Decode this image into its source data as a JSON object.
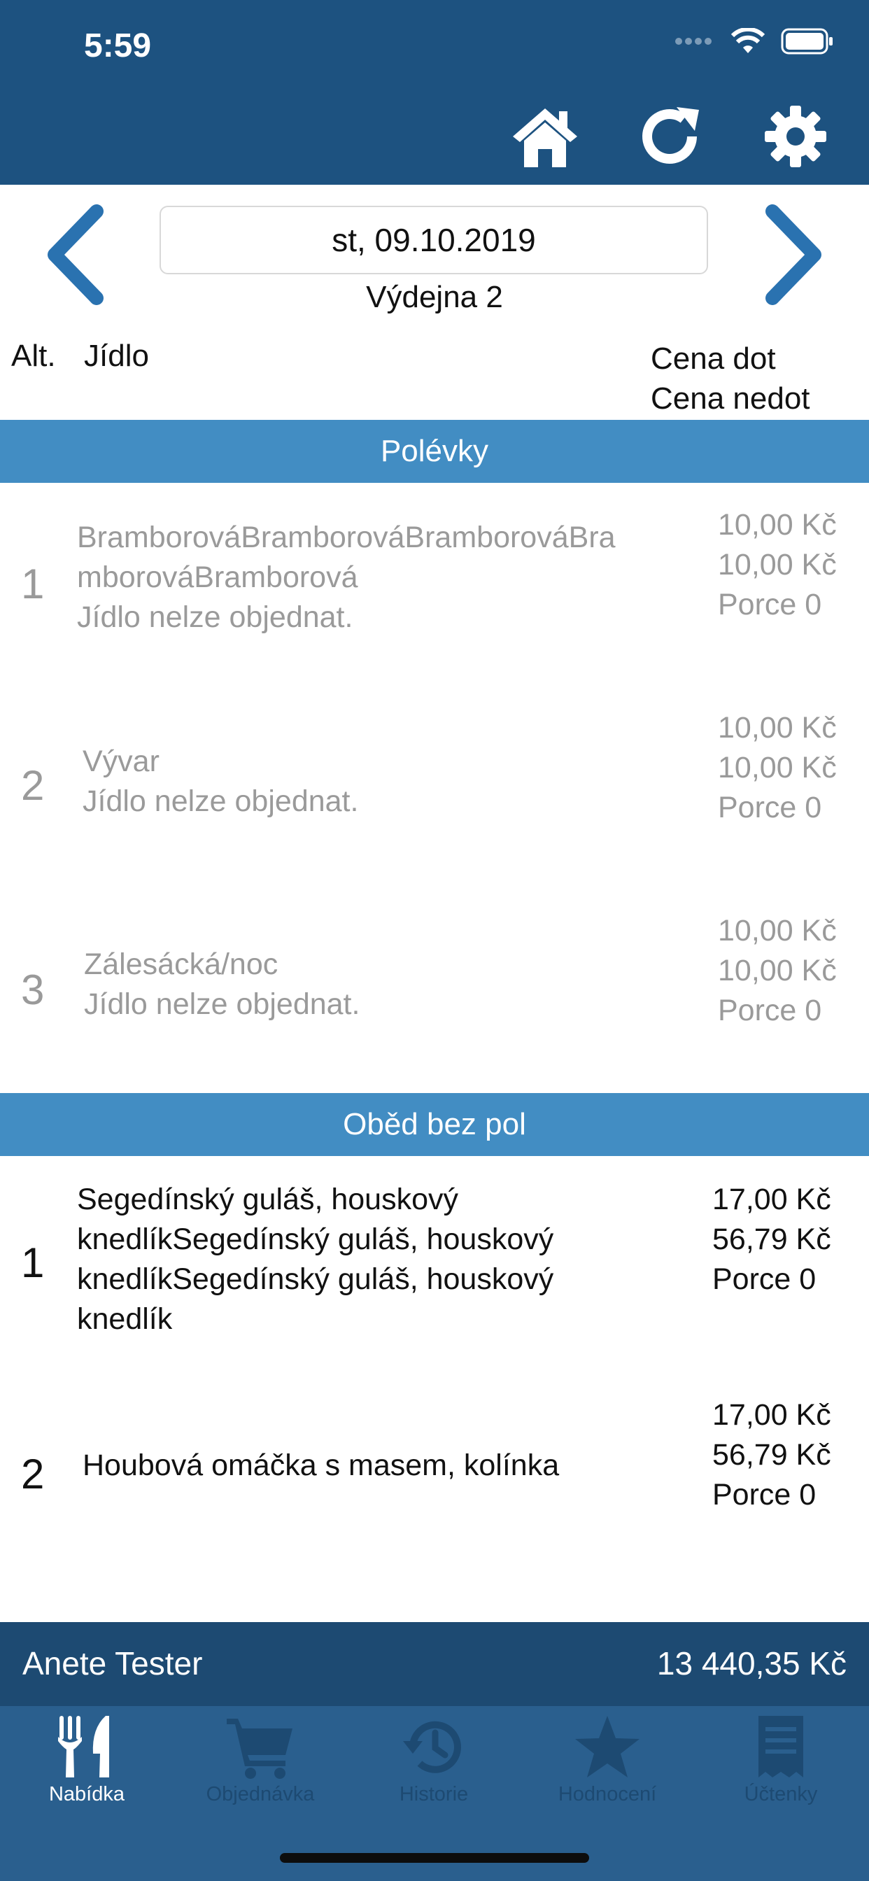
{
  "status": {
    "time": "5:59"
  },
  "header": {
    "icons": [
      "home-icon",
      "refresh-icon",
      "gear-icon"
    ]
  },
  "nav": {
    "date": "st, 09.10.2019",
    "outlet": "Výdejna 2"
  },
  "columns": {
    "alt": "Alt.",
    "food": "Jídlo",
    "price_sub": "Cena dot",
    "price_full": "Cena nedot"
  },
  "sections": [
    {
      "title": "Polévky",
      "items": [
        {
          "num": "1",
          "lines": [
            "BramborováBramborováBramborováBra",
            "mborováBramborová",
            "Jídlo nelze objednat."
          ],
          "p1": "10,00 Kč",
          "p2": "10,00 Kč",
          "portion": "Porce 0"
        },
        {
          "num": "2",
          "lines": [
            "Vývar",
            "Jídlo nelze objednat."
          ],
          "p1": "10,00 Kč",
          "p2": "10,00 Kč",
          "portion": "Porce 0"
        },
        {
          "num": "3",
          "lines": [
            "Zálesácká/noc",
            "Jídlo nelze objednat."
          ],
          "p1": "10,00 Kč",
          "p2": "10,00 Kč",
          "portion": "Porce 0"
        }
      ]
    },
    {
      "title": "Oběd bez pol",
      "items": [
        {
          "num": "1",
          "lines": [
            "Segedínský guláš, houskový",
            "knedlíkSegedínský guláš, houskový",
            "knedlíkSegedínský guláš, houskový",
            "knedlík"
          ],
          "p1": "17,00 Kč",
          "p2": "56,79 Kč",
          "portion": "Porce 0"
        },
        {
          "num": "2",
          "lines": [
            "Houbová omáčka s masem, kolínka"
          ],
          "p1": "17,00 Kč",
          "p2": "56,79 Kč",
          "portion": "Porce 0"
        }
      ]
    }
  ],
  "footer": {
    "user": "Anete Tester",
    "balance": "13 440,35 Kč"
  },
  "tabs": [
    {
      "label": "Nabídka",
      "icon": "fork-knife-icon",
      "active": true
    },
    {
      "label": "Objednávka",
      "icon": "cart-icon",
      "active": false
    },
    {
      "label": "Historie",
      "icon": "history-icon",
      "active": false
    },
    {
      "label": "Hodnocení",
      "icon": "star-icon",
      "active": false
    },
    {
      "label": "Účtenky",
      "icon": "receipt-icon",
      "active": false
    }
  ],
  "colors": {
    "header": "#1d5280",
    "section": "#428dc3",
    "tabbar": "#2a5f8e",
    "tab_inactive": "#1d4a72",
    "disabled_text": "#9a9a9a"
  }
}
